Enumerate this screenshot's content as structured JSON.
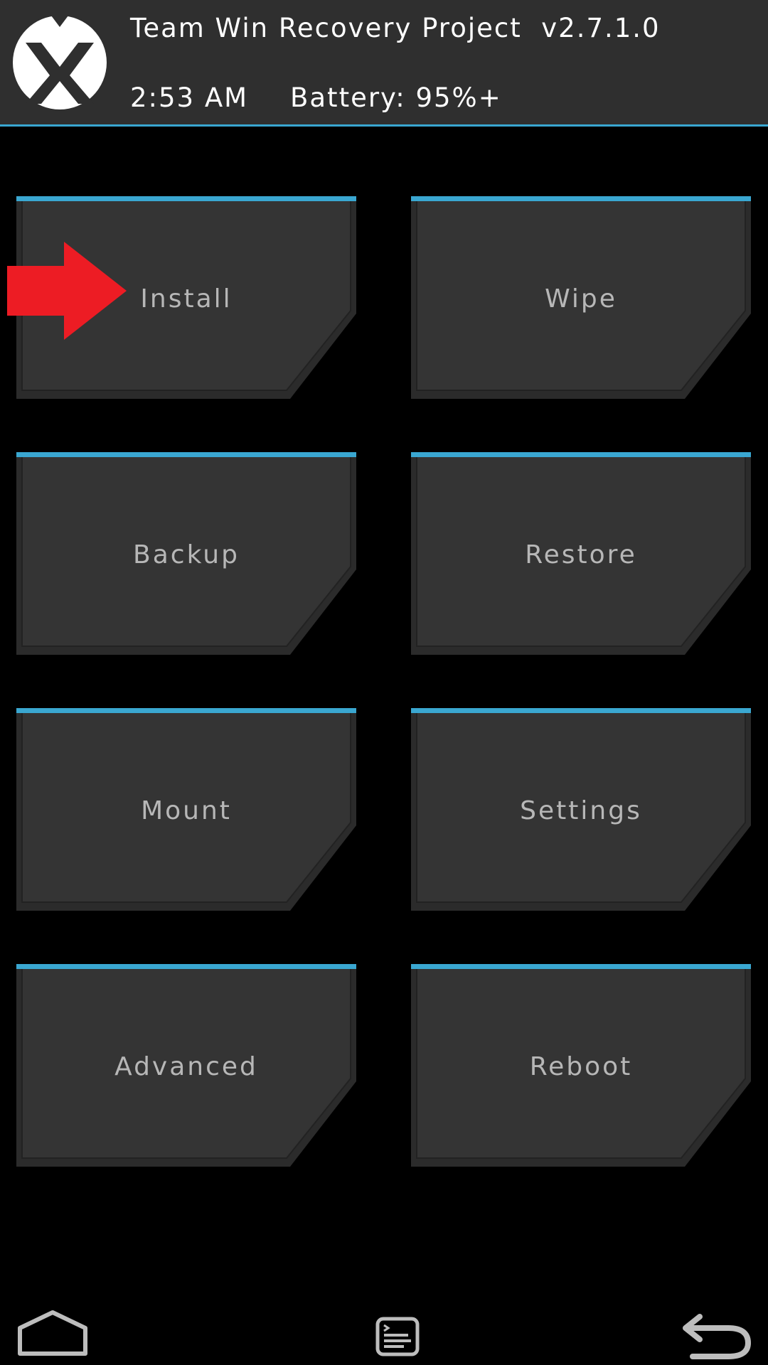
{
  "header": {
    "title": "Team Win Recovery Project  v2.7.1.0",
    "time": "2:53 AM",
    "battery": "Battery: 95%+"
  },
  "menu": {
    "install": "Install",
    "wipe": "Wipe",
    "backup": "Backup",
    "restore": "Restore",
    "mount": "Mount",
    "settings": "Settings",
    "advanced": "Advanced",
    "reboot": "Reboot"
  },
  "colors": {
    "accent": "#3aa7d1",
    "header_bg": "#2f2f2f",
    "tile_bg": "#333333",
    "tile_text": "#b7b7b7",
    "arrow": "#ed1c24"
  },
  "icons": {
    "logo": "twrp-logo",
    "home": "home-icon",
    "console": "console-icon",
    "back": "back-icon"
  }
}
